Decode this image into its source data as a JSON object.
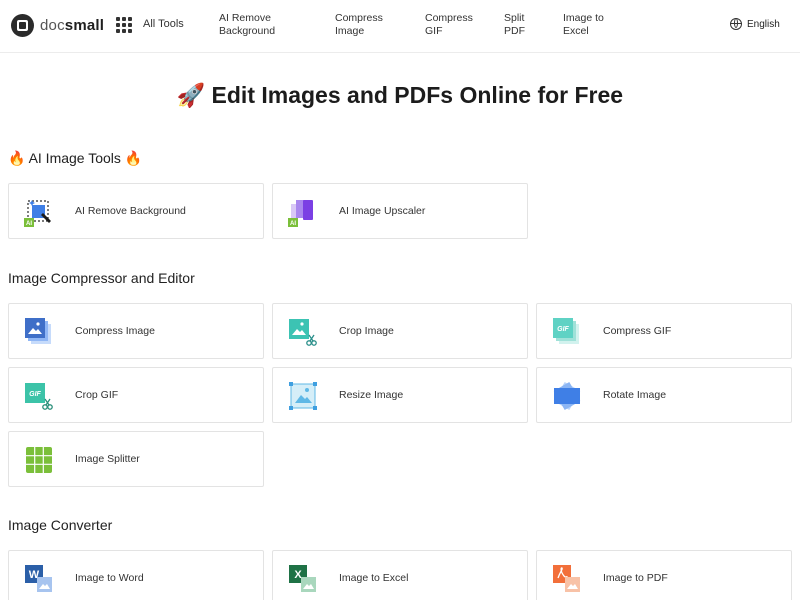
{
  "brand": {
    "text_a": "doc",
    "text_b": "small"
  },
  "nav": {
    "all_tools": "All Tools",
    "items": [
      {
        "line1": "AI Remove",
        "line2": "Background"
      },
      {
        "line1": "Compress",
        "line2": "Image"
      },
      {
        "line1": "Compress",
        "line2": "GIF"
      },
      {
        "line1": "Split",
        "line2": "PDF"
      },
      {
        "line1": "Image to",
        "line2": "Excel"
      }
    ],
    "language": "English"
  },
  "hero": {
    "icon": "rocket-icon",
    "title": "Edit Images and PDFs Online for Free"
  },
  "sections": [
    {
      "title": "AI Image Tools",
      "icon": "fire-icon",
      "tools": [
        {
          "label": "AI Remove Background",
          "icon": "ai-remove-background-icon"
        },
        {
          "label": "AI Image Upscaler",
          "icon": "ai-image-upscaler-icon"
        }
      ]
    },
    {
      "title": "Image Compressor and Editor",
      "tools": [
        {
          "label": "Compress Image",
          "icon": "compress-image-icon"
        },
        {
          "label": "Crop Image",
          "icon": "crop-image-icon"
        },
        {
          "label": "Compress GIF",
          "icon": "compress-gif-icon"
        },
        {
          "label": "Crop GIF",
          "icon": "crop-gif-icon"
        },
        {
          "label": "Resize Image",
          "icon": "resize-image-icon"
        },
        {
          "label": "Rotate Image",
          "icon": "rotate-image-icon"
        },
        {
          "label": "Image Splitter",
          "icon": "image-splitter-icon"
        }
      ]
    },
    {
      "title": "Image Converter",
      "tools": [
        {
          "label": "Image to Word",
          "icon": "image-to-word-icon"
        },
        {
          "label": "Image to Excel",
          "icon": "image-to-excel-icon"
        },
        {
          "label": "Image to PDF",
          "icon": "image-to-pdf-icon"
        }
      ]
    }
  ],
  "icon_text": {
    "ai": "AI",
    "gif": "GIF",
    "word": "W",
    "excel": "X"
  },
  "colors": {
    "blue": "#3f7fe6",
    "teal": "#3cc3b3",
    "green": "#7bbf3a",
    "word_blue": "#2b5fa8",
    "excel_green": "#1f7246",
    "pdf_orange": "#f26f3a",
    "purple": "#7b3fe4"
  }
}
